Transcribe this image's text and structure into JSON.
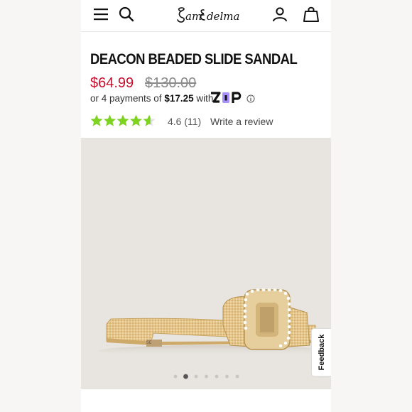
{
  "brand": {
    "logo_text": "Sam Edelman"
  },
  "header": {
    "icons": [
      "menu-icon",
      "search-icon",
      "account-icon",
      "bag-icon"
    ]
  },
  "product": {
    "title": "DEACON BEADED SLIDE SANDAL",
    "sale_price": "$64.99",
    "original_price": "$130.00"
  },
  "installments": {
    "prefix": "or 4 payments of",
    "amount": "$17.25",
    "suffix": "with",
    "provider": "Zip",
    "info_icon": "info-icon"
  },
  "rating": {
    "value": 4.6,
    "max": 5,
    "display": "4.6 (11)",
    "review_link": "Write a review",
    "star_color": "#7ed321"
  },
  "gallery": {
    "image_count": 7,
    "active_index": 1
  },
  "feedback": {
    "label": "Feedback"
  },
  "colors": {
    "sale": "#c8102e",
    "original_price": "#8a8a8a",
    "zip_purple": "#aa8fff",
    "stars": "#7ed321"
  }
}
